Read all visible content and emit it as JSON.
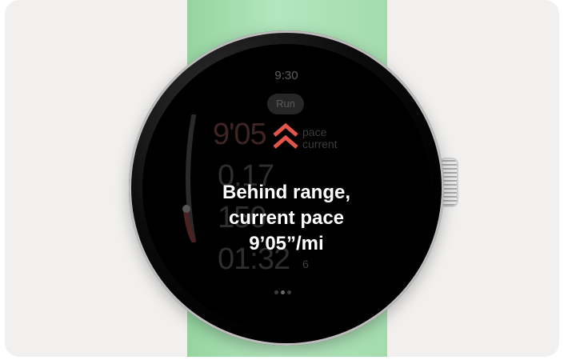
{
  "watch": {
    "time": "9:30",
    "workout_label": "Run",
    "background_stats": {
      "pace_value": "9'05",
      "pace_label_1": "pace",
      "pace_label_2": "current",
      "distance_value": "0.17",
      "heart_rate_value": "150",
      "duration_value": "01:32",
      "duration_suffix": "6"
    },
    "alert": {
      "line1": "Behind range,",
      "line2": "current pace",
      "line3": "9’05”/mi",
      "icon": "double-chevron-up-icon",
      "icon_color": "#e2554b"
    },
    "page_indicator_count": 3
  },
  "colors": {
    "strap": "#a6ddb0",
    "background": "#f1f0ee",
    "screen": "#000000",
    "alert_text": "#ffffff"
  }
}
